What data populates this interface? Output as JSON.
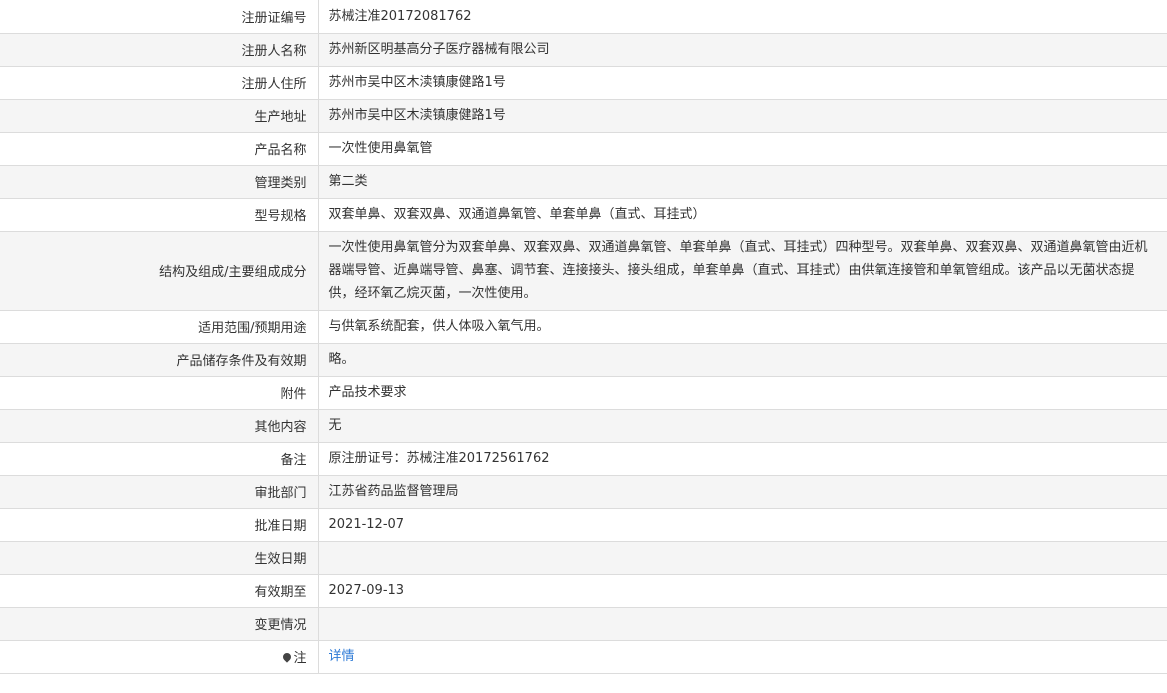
{
  "rows": [
    {
      "label": "注册证编号",
      "value": "苏械注准20172081762"
    },
    {
      "label": "注册人名称",
      "value": "苏州新区明基高分子医疗器械有限公司"
    },
    {
      "label": "注册人住所",
      "value": "苏州市吴中区木渎镇康健路1号"
    },
    {
      "label": "生产地址",
      "value": "苏州市吴中区木渎镇康健路1号"
    },
    {
      "label": "产品名称",
      "value": "一次性使用鼻氧管"
    },
    {
      "label": "管理类别",
      "value": "第二类"
    },
    {
      "label": "型号规格",
      "value": "双套单鼻、双套双鼻、双通道鼻氧管、单套单鼻（直式、耳挂式）"
    },
    {
      "label": "结构及组成/主要组成成分",
      "value": "一次性使用鼻氧管分为双套单鼻、双套双鼻、双通道鼻氧管、单套单鼻（直式、耳挂式）四种型号。双套单鼻、双套双鼻、双通道鼻氧管由近机器端导管、近鼻端导管、鼻塞、调节套、连接接头、接头组成，单套单鼻（直式、耳挂式）由供氧连接管和单氧管组成。该产品以无菌状态提供，经环氧乙烷灭菌，一次性使用。"
    },
    {
      "label": "适用范围/预期用途",
      "value": "与供氧系统配套，供人体吸入氧气用。"
    },
    {
      "label": "产品储存条件及有效期",
      "value": "略。"
    },
    {
      "label": "附件",
      "value": "产品技术要求"
    },
    {
      "label": "其他内容",
      "value": "无"
    },
    {
      "label": "备注",
      "value": "原注册证号：苏械注准20172561762"
    },
    {
      "label": "审批部门",
      "value": "江苏省药品监督管理局"
    },
    {
      "label": "批准日期",
      "value": "2021-12-07"
    },
    {
      "label": "生效日期",
      "value": ""
    },
    {
      "label": "有效期至",
      "value": "2027-09-13"
    },
    {
      "label": "变更情况",
      "value": ""
    }
  ],
  "note_row": {
    "label": "注",
    "icon": "pin-icon",
    "link_text": "详情"
  }
}
